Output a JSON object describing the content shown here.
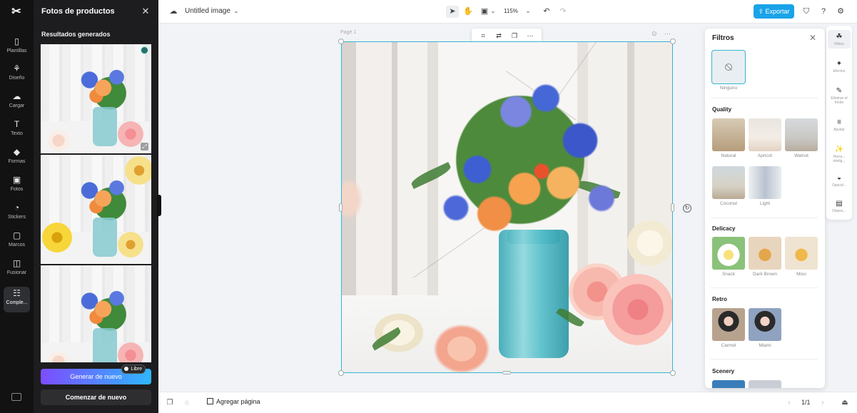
{
  "rail": {
    "items": [
      {
        "label": "Plantillas",
        "icon": "templates-icon",
        "glyph": "▯"
      },
      {
        "label": "Diseño",
        "icon": "design-icon",
        "glyph": "⚘"
      },
      {
        "label": "Cargar",
        "icon": "upload-icon",
        "glyph": "☁"
      },
      {
        "label": "Texto",
        "icon": "text-icon",
        "glyph": "T"
      },
      {
        "label": "Formas",
        "icon": "shapes-icon",
        "glyph": "◆"
      },
      {
        "label": "Fotos",
        "icon": "photos-icon",
        "glyph": "▣"
      },
      {
        "label": "Stickers",
        "icon": "stickers-icon",
        "glyph": "◔"
      },
      {
        "label": "Marcos",
        "icon": "frames-icon",
        "glyph": "▢"
      },
      {
        "label": "Fusionar",
        "icon": "merge-icon",
        "glyph": "◫"
      },
      {
        "label": "Comple...",
        "icon": "plugins-icon",
        "glyph": "☷"
      }
    ]
  },
  "panel": {
    "title": "Fotos de productos",
    "subtitle": "Resultados generados",
    "generate_label": "Generar de nuevo",
    "free_badge": "Libre",
    "start_label": "Comenzar de nuevo"
  },
  "topbar": {
    "doc_title": "Untitled image",
    "zoom": "115%",
    "export_label": "Exportar"
  },
  "canvas": {
    "page_label": "Page 1"
  },
  "bottombar": {
    "add_page": "Agregar página",
    "page_count": "1/1"
  },
  "filters": {
    "title": "Filtros",
    "none_label": "Ninguno",
    "sections": [
      {
        "name": "Quality",
        "items": [
          "Natural",
          "Apricot",
          "Walnut",
          "Coconut",
          "Light"
        ]
      },
      {
        "name": "Delicacy",
        "items": [
          "Snack",
          "Dark Brown",
          "Miso"
        ]
      },
      {
        "name": "Retro",
        "items": [
          "Carmel",
          "Miami"
        ]
      },
      {
        "name": "Scenery",
        "items": []
      }
    ]
  },
  "right_tools": [
    {
      "label": "Filtros",
      "icon": "filters-icon",
      "glyph": "☘"
    },
    {
      "label": "Efectos",
      "icon": "effects-icon",
      "glyph": "✦"
    },
    {
      "label": "Eliminar el fondo",
      "icon": "remove-bg-icon",
      "glyph": "✎"
    },
    {
      "label": "Ajustar",
      "icon": "adjust-icon",
      "glyph": "≡"
    },
    {
      "label": "Herra... intelig...",
      "icon": "smart-tools-icon",
      "glyph": "✨"
    },
    {
      "label": "Opacid...",
      "icon": "opacity-icon",
      "glyph": "◒"
    },
    {
      "label": "Dispos...",
      "icon": "arrange-icon",
      "glyph": "▤"
    }
  ],
  "colors": {
    "accent": "#35b6d4",
    "export": "#1aa3e8",
    "rail_bg": "#121212",
    "panel_bg": "#1d1d1f"
  }
}
